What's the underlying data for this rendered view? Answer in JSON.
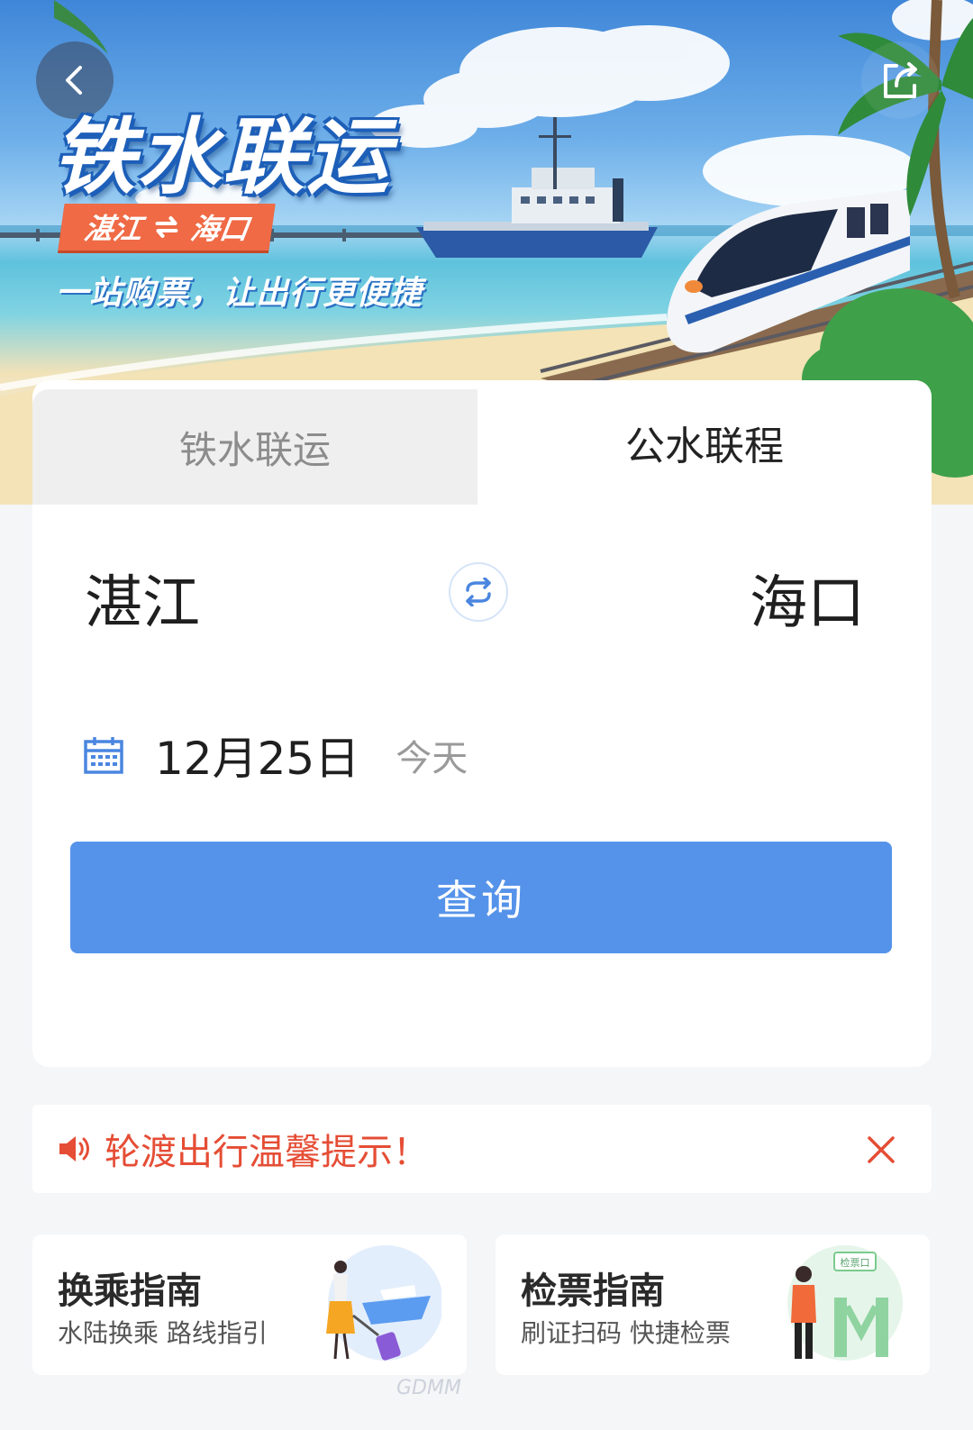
{
  "header": {
    "back_icon": "chevron-left-icon",
    "share_icon": "share-icon"
  },
  "banner": {
    "title": "铁水联运",
    "route_from": "湛江",
    "route_to": "海口",
    "route_arrow_icon": "swap-arrows-icon",
    "slogan": "一站购票，让出行更便捷"
  },
  "tabs": [
    {
      "label": "铁水联运",
      "active": false
    },
    {
      "label": "公水联程",
      "active": true
    }
  ],
  "search": {
    "from_city": "湛江",
    "to_city": "海口",
    "swap_icon": "swap-icon",
    "calendar_icon": "calendar-icon",
    "date": "12月25日",
    "date_sub": "今天",
    "query_label": "查询"
  },
  "notice": {
    "speaker_icon": "speaker-icon",
    "text": "轮渡出行温馨提示！",
    "close_icon": "close-icon"
  },
  "guides": [
    {
      "title": "换乘指南",
      "subtitle": "水陆换乘 路线指引",
      "art": "traveler-ship-illustration"
    },
    {
      "title": "检票指南",
      "subtitle": "刷证扫码 快捷检票",
      "art": "ticket-gate-illustration",
      "art_sign": "检票口"
    }
  ],
  "colors": {
    "primary": "#5593ea",
    "notice": "#e54d35",
    "tag": "#ef6a45"
  }
}
